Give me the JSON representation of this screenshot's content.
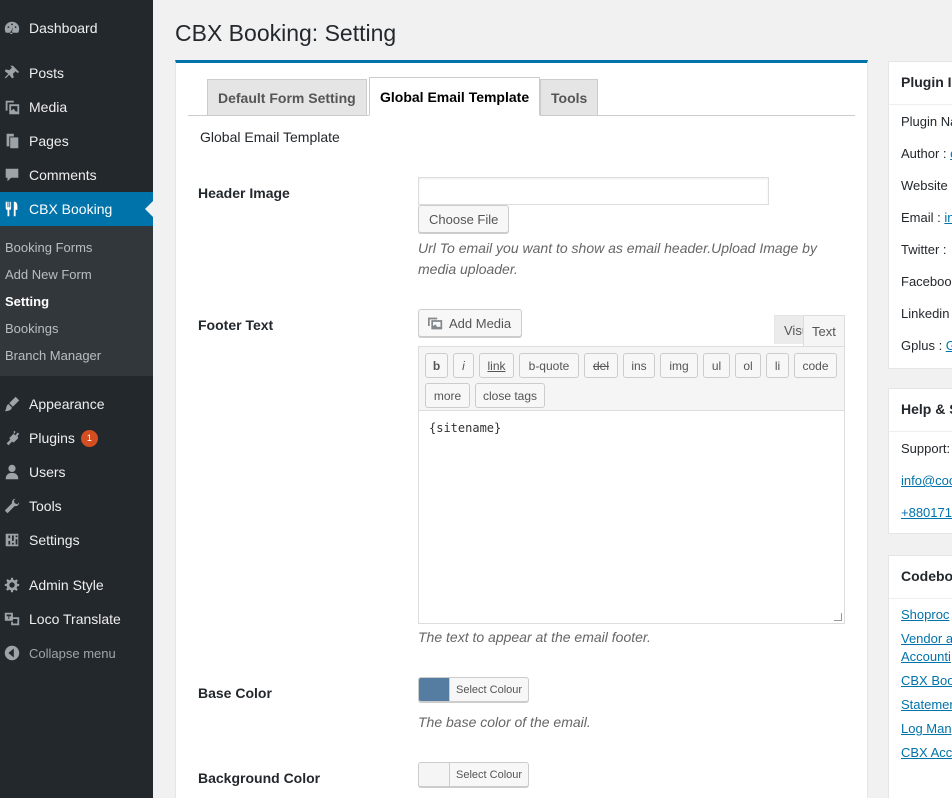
{
  "sidebar": {
    "menu": [
      {
        "label": "Dashboard",
        "icon": "dashboard-icon"
      },
      {
        "label": "Posts",
        "icon": "pin-icon"
      },
      {
        "label": "Media",
        "icon": "media-icon"
      },
      {
        "label": "Pages",
        "icon": "pages-icon"
      },
      {
        "label": "Comments",
        "icon": "comment-icon"
      },
      {
        "label": "CBX Booking",
        "icon": "utensils-icon"
      },
      {
        "label": "Appearance",
        "icon": "brush-icon"
      },
      {
        "label": "Plugins",
        "icon": "plug-icon",
        "badge": "1"
      },
      {
        "label": "Users",
        "icon": "user-icon"
      },
      {
        "label": "Tools",
        "icon": "wrench-icon"
      },
      {
        "label": "Settings",
        "icon": "sliders-icon"
      },
      {
        "label": "Admin Style",
        "icon": "gear-icon"
      },
      {
        "label": "Loco Translate",
        "icon": "translate-icon"
      }
    ],
    "submenu": [
      "Booking Forms",
      "Add New Form",
      "Setting",
      "Bookings",
      "Branch Manager"
    ],
    "collapse_label": "Collapse menu"
  },
  "page": {
    "title": "CBX Booking: Setting"
  },
  "tabs": [
    "Default Form Setting",
    "Global Email Template",
    "Tools"
  ],
  "section_title": "Global Email Template",
  "fields": {
    "header_image": {
      "label": "Header Image",
      "value": "",
      "button": "Choose File",
      "description": "Url To email you want to show as email header.Upload Image by media uploader."
    },
    "footer_text": {
      "label": "Footer Text",
      "add_media": "Add Media",
      "editor_tabs": {
        "visual": "Visual",
        "text": "Text"
      },
      "quicktags": [
        "b",
        "i",
        "link",
        "b-quote",
        "del",
        "ins",
        "img",
        "ul",
        "ol",
        "li",
        "code",
        "more",
        "close tags"
      ],
      "content": "{sitename}",
      "description": "The text to appear at the email footer."
    },
    "base_color": {
      "label": "Base Color",
      "button": "Select Colour",
      "color": "#557da1",
      "description": "The base color of the email."
    },
    "background_color": {
      "label": "Background Color",
      "button": "Select Colour",
      "color": "#f5f5f5"
    }
  },
  "right_boxes": {
    "plugin_info": {
      "title": "Plugin In",
      "lines": [
        {
          "label": "Plugin Na",
          "link": ""
        },
        {
          "label": "Author : ",
          "link": "c"
        },
        {
          "label": "Website",
          "link": ""
        },
        {
          "label": "Email : ",
          "link": "in"
        },
        {
          "label": "Twitter :",
          "link": ""
        },
        {
          "label": "Faceboo",
          "link": ""
        },
        {
          "label": "Linkedin",
          "link": ""
        },
        {
          "label": "Gplus : ",
          "link": "G"
        }
      ]
    },
    "help": {
      "title": "Help & S",
      "support": "Support:",
      "links": [
        "info@coo",
        "+880171"
      ]
    },
    "codeboxr": {
      "title": "Codebo",
      "links": [
        "Shoproc",
        "Vendor a",
        "Accounti",
        "CBX Boo",
        "Statemer",
        "Log Man",
        "CBX Acc"
      ]
    }
  },
  "colors": {
    "accent": "#0073aa",
    "sidebar_bg": "#23282d",
    "submenu_bg": "#32373c",
    "badge": "#d54e21"
  }
}
